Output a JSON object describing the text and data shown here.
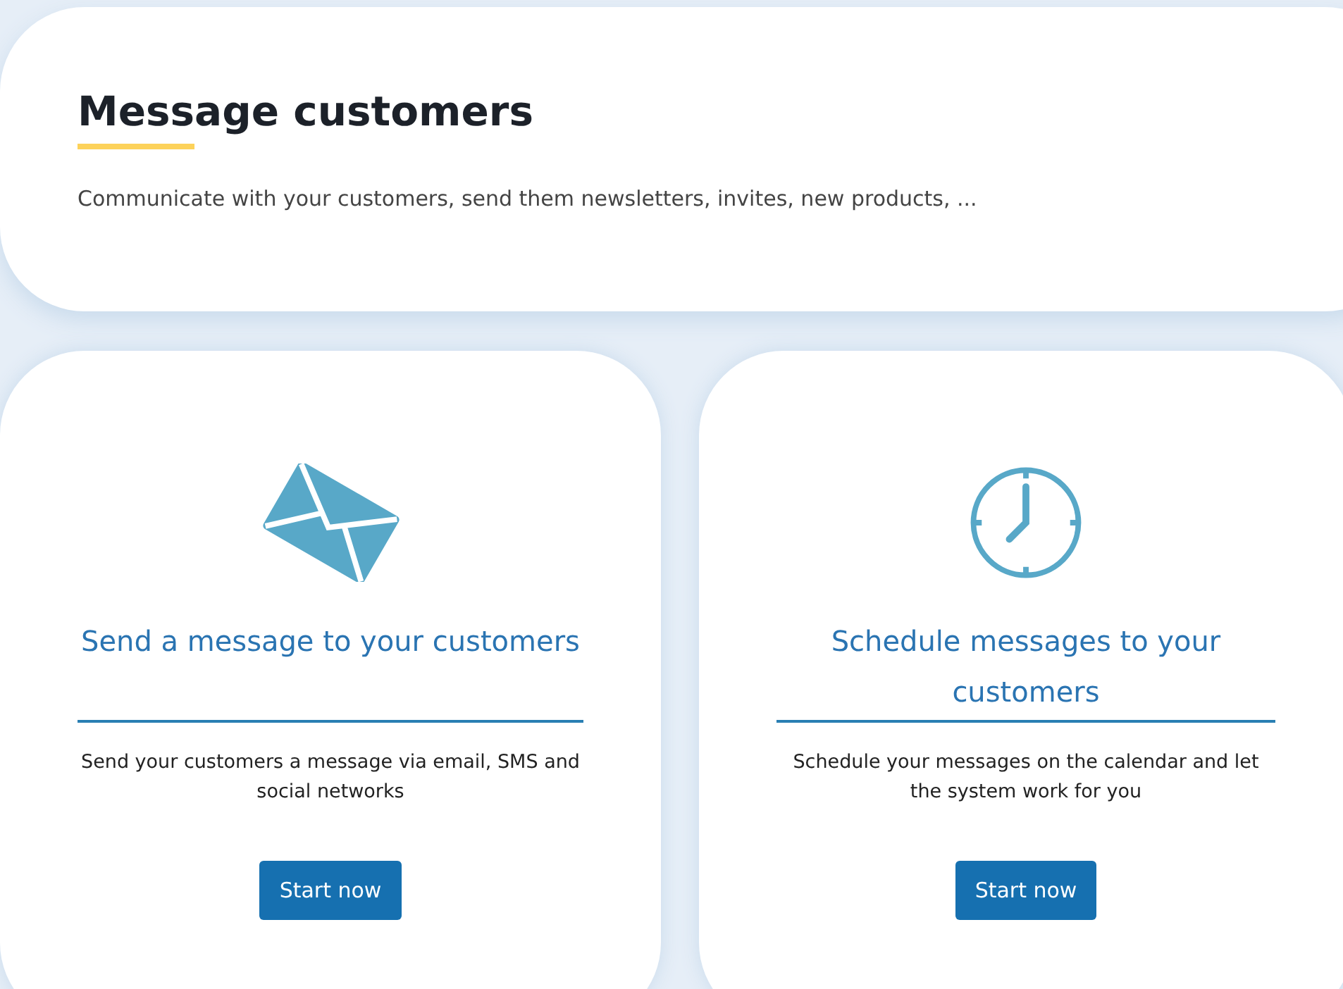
{
  "header": {
    "title": "Message customers",
    "description": "Communicate with your customers, send them newsletters, invites, new products, ..."
  },
  "cards": [
    {
      "kind": "envelope",
      "title": "Send a message to your customers",
      "description": "Send your customers a message via email, SMS and social networks",
      "button": "Start now"
    },
    {
      "kind": "clock",
      "title": "Schedule messages to your customers",
      "description": "Schedule your messages on the calendar and let the system work for you",
      "button": "Start now"
    }
  ]
}
